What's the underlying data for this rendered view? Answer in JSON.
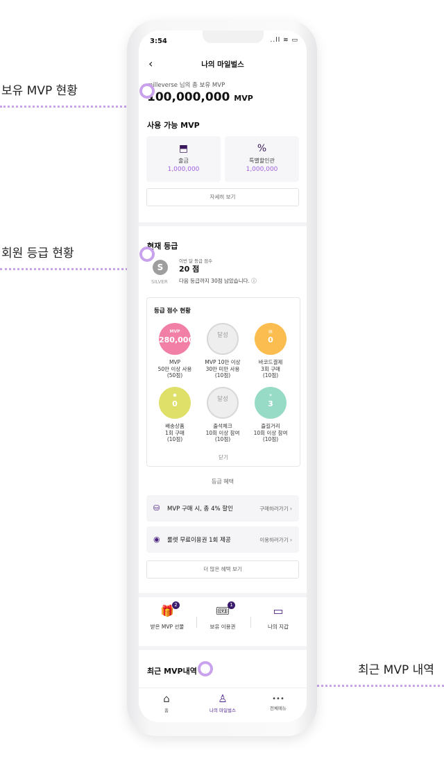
{
  "callouts": {
    "owned_mvp": "보유 MVP 현황",
    "member_grade": "회원 등급 현황",
    "recent_mvp": "최근 MVP 내역"
  },
  "status_bar": {
    "time": "3:54",
    "icons": "..ll ≋ ▭"
  },
  "header": {
    "back_glyph": "‹",
    "title": "나의 마일벌스"
  },
  "mvp_summary": {
    "owner_line": "milleverse 님의 총 보유 MVP",
    "total": "100,000,000",
    "unit": "MVP"
  },
  "available": {
    "title": "사용 가능 MVP",
    "items": [
      {
        "icon": "withdraw-icon",
        "glyph": "⬒",
        "label": "출금",
        "value": "1,000,000"
      },
      {
        "icon": "discount-bag-icon",
        "glyph": "%",
        "label": "특별할인관",
        "value": "1,000,000"
      }
    ],
    "detail_button": "자세히 보기"
  },
  "grade": {
    "title": "현재 등급",
    "letter": "S",
    "name": "SILVER",
    "score_caption": "이번 달 등급 점수",
    "score": "20 점",
    "next_info": "다음 등급까지 30점 남았습니다.",
    "info_glyph": "ⓘ",
    "status_title": "등급 점수 현황",
    "circles": [
      {
        "top": "MVP",
        "value": "280,000",
        "color": "#f27fa6",
        "label": "MVP\n50만 이상 사용\n(50점)"
      },
      {
        "top": "",
        "value": "달성",
        "color": "#eeeeee",
        "label": "MVP 10만 이상\n30만 미만 사용\n(10점)"
      },
      {
        "top": "▤",
        "value": "0",
        "color": "#fbbd4f",
        "label": "바코드결제\n3회 구매\n(10점)"
      },
      {
        "top": "⬢",
        "value": "0",
        "color": "#dfe06a",
        "label": "배송상품\n1회 구매\n(10점)"
      },
      {
        "top": "",
        "value": "달성",
        "color": "#eeeeee",
        "label": "출석체크\n10회 이상 참여\n(10점)"
      },
      {
        "top": "✦",
        "value": "3",
        "color": "#97dbc7",
        "label": "즐길거리\n10회 이상 참여\n(10점)"
      }
    ],
    "close_label": "닫기",
    "benefit_title": "등급 혜택",
    "benefits": [
      {
        "icon": "discount-icon",
        "glyph": "⛁",
        "text": "MVP 구매 시, 총 4% 할인",
        "link": "구매하러가기 ›"
      },
      {
        "icon": "roulette-icon",
        "glyph": "◉",
        "text": "룰렛 무료이용권 1회 제공",
        "link": "이용하러가기 ›"
      }
    ],
    "more_benefits": "더 많은 혜택 보기"
  },
  "quick_actions": [
    {
      "icon": "gift-icon",
      "glyph": "🎁",
      "badge": "2",
      "label": "받은 MVP 선물"
    },
    {
      "icon": "ticket-icon",
      "glyph": "🎟",
      "badge": "1",
      "label": "보유 이용권"
    },
    {
      "icon": "wallet-icon",
      "glyph": "▭",
      "badge": "",
      "label": "나의 지갑"
    }
  ],
  "recent": {
    "title": "최근 MVP내역"
  },
  "tabbar": [
    {
      "icon": "home-icon",
      "glyph": "⌂",
      "label": "홈",
      "color": "#555555"
    },
    {
      "icon": "profile-icon",
      "glyph": "♙",
      "label": "나의 마일벌스",
      "color": "#4b1f8a"
    },
    {
      "icon": "more-icon",
      "glyph": "•••",
      "label": "전체메뉴",
      "color": "#555555"
    }
  ]
}
